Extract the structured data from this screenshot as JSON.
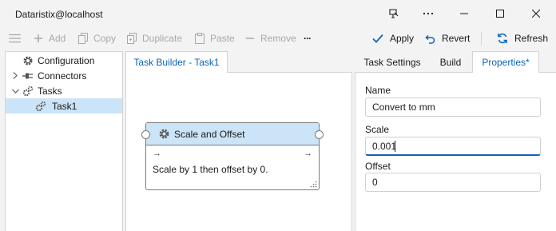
{
  "window": {
    "title": "Dataristix@localhost",
    "buttons": [
      "pin-window-icon",
      "more-icon",
      "minimize-icon",
      "maximize-icon",
      "close-icon"
    ]
  },
  "toolbar": {
    "add": "Add",
    "copy": "Copy",
    "duplicate": "Duplicate",
    "paste": "Paste",
    "remove": "Remove",
    "more": "···",
    "apply": "Apply",
    "revert": "Revert",
    "refresh": "Refresh"
  },
  "tree": {
    "items": [
      {
        "label": "Configuration",
        "icon": "gear-icon"
      },
      {
        "label": "Connectors",
        "icon": "plug-icon"
      },
      {
        "label": "Tasks",
        "icon": "gears-icon"
      },
      {
        "label": "Task1",
        "icon": "gears-icon",
        "selected": true
      }
    ]
  },
  "builder": {
    "tab": "Task Builder - Task1",
    "node": {
      "title": "Scale and Offset",
      "in_arrow": "→",
      "out_arrow": "→",
      "description": "Scale by 1 then offset by 0."
    }
  },
  "right_tabs": {
    "task_settings": "Task Settings",
    "build": "Build",
    "properties": "Properties*"
  },
  "properties": {
    "name_label": "Name",
    "name_value": "Convert to mm",
    "scale_label": "Scale",
    "scale_value": "0.001",
    "offset_label": "Offset",
    "offset_value": "0"
  },
  "colors": {
    "accent": "#0a63b8",
    "selection": "#cce4f7",
    "disabled_text": "#a8a8a8"
  }
}
